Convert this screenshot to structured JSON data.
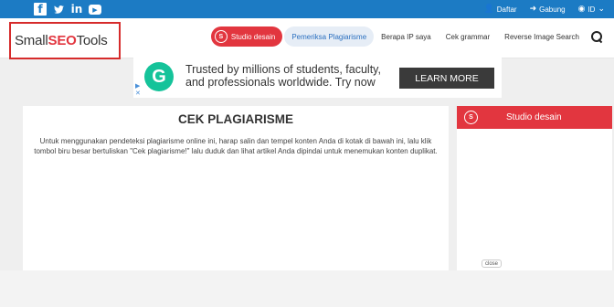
{
  "topbar": {
    "social": [
      "facebook-icon",
      "twitter-icon",
      "linkedin-icon",
      "youtube-icon"
    ],
    "register_label": "Daftar",
    "login_label": "Gabung",
    "language_label": "ID"
  },
  "header": {
    "logo": {
      "part1": "Small",
      "part2": "SEO",
      "part3": "Tools"
    },
    "nav": {
      "design_studio": "Studio desain",
      "plagiarism_checker": "Pemeriksa Plagiarisme",
      "my_ip": "Berapa IP saya",
      "grammar": "Cek grammar",
      "reverse_image": "Reverse Image Search"
    }
  },
  "ad": {
    "logo_letter": "G",
    "text": "Trusted by millions of students, faculty, and professionals worldwide. Try now",
    "button": "LEARN MORE"
  },
  "main": {
    "title": "CEK PLAGIARISME",
    "description": "Untuk menggunakan pendeteksi plagiarisme online ini, harap salin dan tempel konten Anda di kotak di bawah ini, lalu klik tombol biru besar bertuliskan \"Cek plagiarisme!\" lalu duduk dan lihat artikel Anda dipindai untuk menemukan konten duplikat."
  },
  "sidebar": {
    "title": "Studio desain",
    "close_label": "close"
  },
  "colors": {
    "brand_blue": "#1c7bc4",
    "brand_red": "#e2363f",
    "grammarly_green": "#15c39a"
  }
}
